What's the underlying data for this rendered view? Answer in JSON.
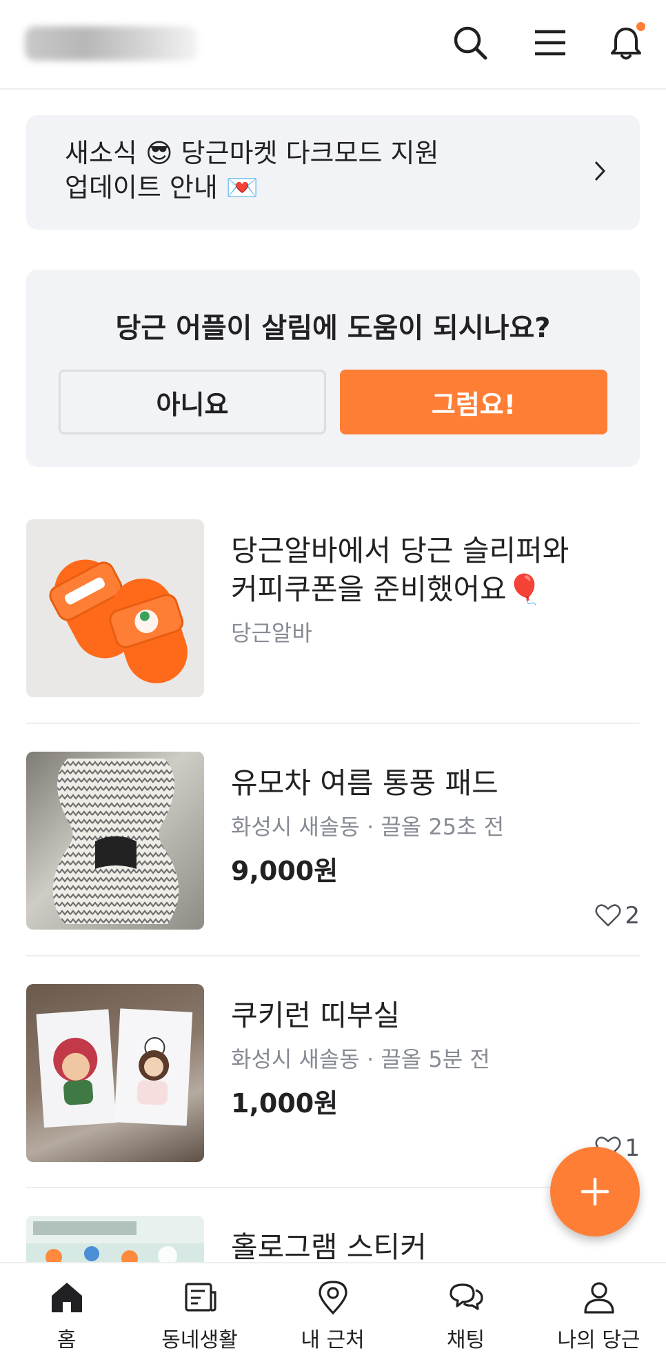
{
  "header": {
    "icons": [
      "search-icon",
      "menu-icon",
      "bell-icon"
    ],
    "notification_dot_color": "#ff7e36"
  },
  "news": {
    "line1": "새소식 😎 당근마켓 다크모드 지원",
    "line2": "업데이트 안내 💌"
  },
  "survey": {
    "question": "당근 어플이 살림에 도움이 되시나요?",
    "no_label": "아니요",
    "yes_label": "그럼요!"
  },
  "feed": [
    {
      "title_line1": "당근알바에서 당근 슬리퍼와",
      "title_line2": "커피쿠폰을 준비했어요🎈",
      "source": "당근알바"
    },
    {
      "title": "유모차 여름 통풍 패드",
      "meta": "화성시 새솔동 · 끌올 25초 전",
      "price": "9,000원",
      "likes": "2"
    },
    {
      "title": "쿠키런 띠부실",
      "meta": "화성시 새솔동 · 끌올 5분 전",
      "price": "1,000원",
      "likes": "1"
    },
    {
      "title": "홀로그램 스티커"
    }
  ],
  "fab": {
    "icon": "plus-icon"
  },
  "bottom_nav": [
    {
      "label": "홈",
      "icon": "home-icon"
    },
    {
      "label": "동네생활",
      "icon": "news-icon"
    },
    {
      "label": "내 근처",
      "icon": "location-pin-icon"
    },
    {
      "label": "채팅",
      "icon": "chat-icon"
    },
    {
      "label": "나의 당근",
      "icon": "person-icon"
    }
  ],
  "colors": {
    "accent": "#ff7e36",
    "card_bg": "#f2f3f6",
    "meta_text": "#868b94"
  }
}
